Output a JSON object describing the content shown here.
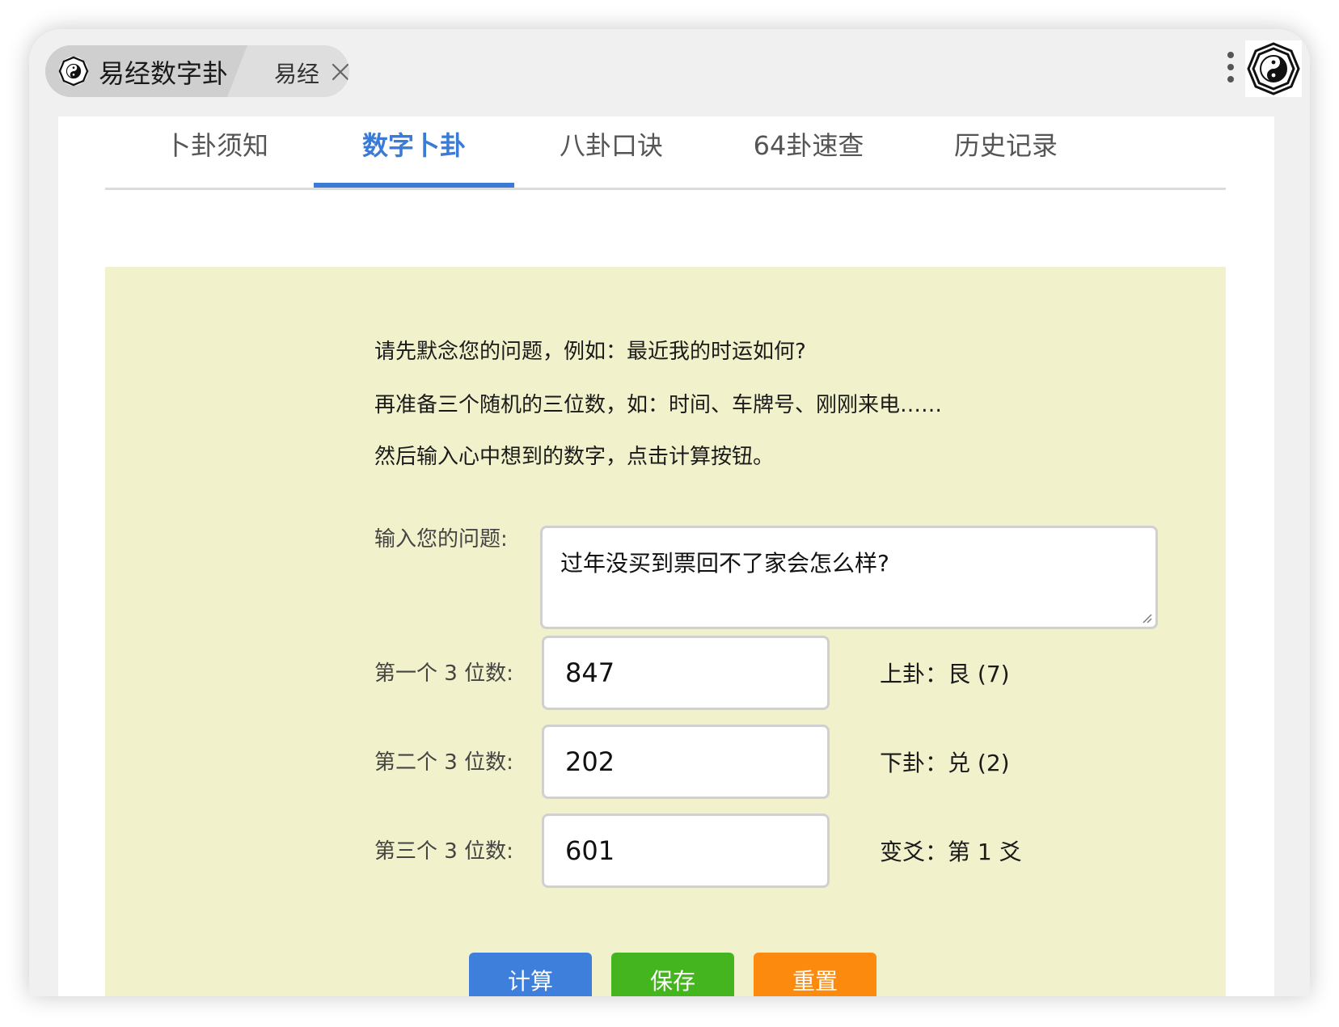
{
  "browser": {
    "tab_title": "易经数字卦",
    "tab_second": "易经"
  },
  "nav": {
    "tabs": [
      "卜卦须知",
      "数字卜卦",
      "八卦口诀",
      "64卦速查",
      "历史记录"
    ],
    "active_index": 1
  },
  "intro": {
    "line1": "请先默念您的问题，例如：最近我的时运如何?",
    "line2": "再准备三个随机的三位数，如：时间、车牌号、刚刚来电……",
    "line3": "然后输入心中想到的数字，点击计算按钮。"
  },
  "form": {
    "question_label": "输入您的问题:",
    "question_value": "过年没买到票回不了家会怎么样?",
    "num1_label": "第一个 3 位数:",
    "num1_value": "847",
    "num2_label": "第二个 3 位数:",
    "num2_value": "202",
    "num3_label": "第三个 3 位数:",
    "num3_value": "601"
  },
  "results": {
    "upper": "上卦：艮 (7)",
    "lower": "下卦：兑 (2)",
    "changing": "变爻：第 1 爻"
  },
  "buttons": {
    "calc": "计算",
    "save": "保存",
    "reset": "重置"
  },
  "colors": {
    "accent_blue": "#3a7bd5",
    "panel_bg": "#f1f1cc",
    "btn_calc": "#3d7fdb",
    "btn_save": "#45b51f",
    "btn_reset": "#fb8a0f"
  },
  "icons": {
    "tab_logo": "bagua-yin-yang-icon",
    "tab_close": "close-icon",
    "menu": "kebab-menu-icon",
    "corner_logo": "bagua-yin-yang-icon"
  }
}
